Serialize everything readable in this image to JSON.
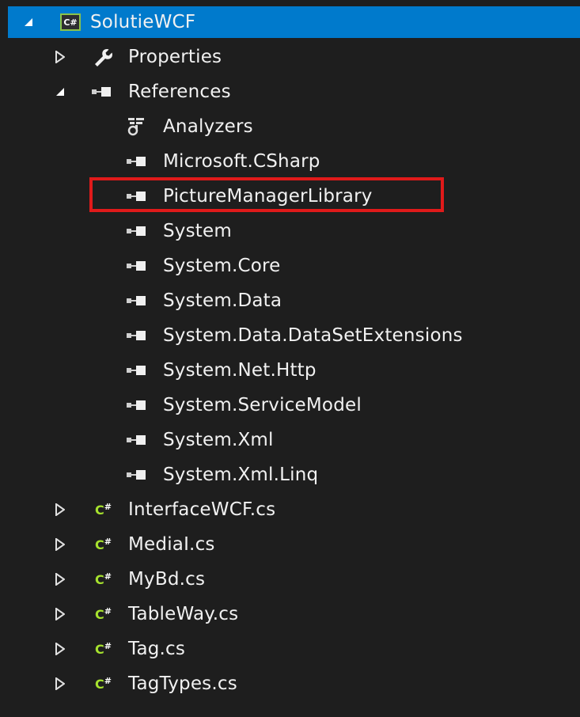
{
  "project": {
    "label": "SolutieWCF",
    "icon": "csharp-project-icon",
    "expanded": true
  },
  "nodes": {
    "properties": {
      "label": "Properties",
      "icon": "wrench-icon",
      "expanded": false
    },
    "references": {
      "label": "References",
      "icon": "reference-icon",
      "expanded": true,
      "children": [
        {
          "label": "Analyzers",
          "icon": "analyzer-icon"
        },
        {
          "label": "Microsoft.CSharp",
          "icon": "reference-icon"
        },
        {
          "label": "PictureManagerLibrary",
          "icon": "reference-icon",
          "highlighted": true
        },
        {
          "label": "System",
          "icon": "reference-icon"
        },
        {
          "label": "System.Core",
          "icon": "reference-icon"
        },
        {
          "label": "System.Data",
          "icon": "reference-icon"
        },
        {
          "label": "System.Data.DataSetExtensions",
          "icon": "reference-icon"
        },
        {
          "label": "System.Net.Http",
          "icon": "reference-icon"
        },
        {
          "label": "System.ServiceModel",
          "icon": "reference-icon"
        },
        {
          "label": "System.Xml",
          "icon": "reference-icon"
        },
        {
          "label": "System.Xml.Linq",
          "icon": "reference-icon"
        }
      ]
    },
    "files": [
      {
        "label": "InterfaceWCF.cs",
        "icon": "csharp-file-icon"
      },
      {
        "label": "MediaI.cs",
        "icon": "csharp-file-icon"
      },
      {
        "label": "MyBd.cs",
        "icon": "csharp-file-icon"
      },
      {
        "label": "TableWay.cs",
        "icon": "csharp-file-icon"
      },
      {
        "label": "Tag.cs",
        "icon": "csharp-file-icon"
      },
      {
        "label": "TagTypes.cs",
        "icon": "csharp-file-icon"
      }
    ]
  },
  "icons": {
    "csharp_glyph": "C",
    "csharp_sup": "#",
    "project_glyph": "C#"
  },
  "colors": {
    "background": "#1e1e1e",
    "selection": "#007acc",
    "highlight_border": "#e01a1a",
    "csharp_green": "#a6e22e"
  }
}
